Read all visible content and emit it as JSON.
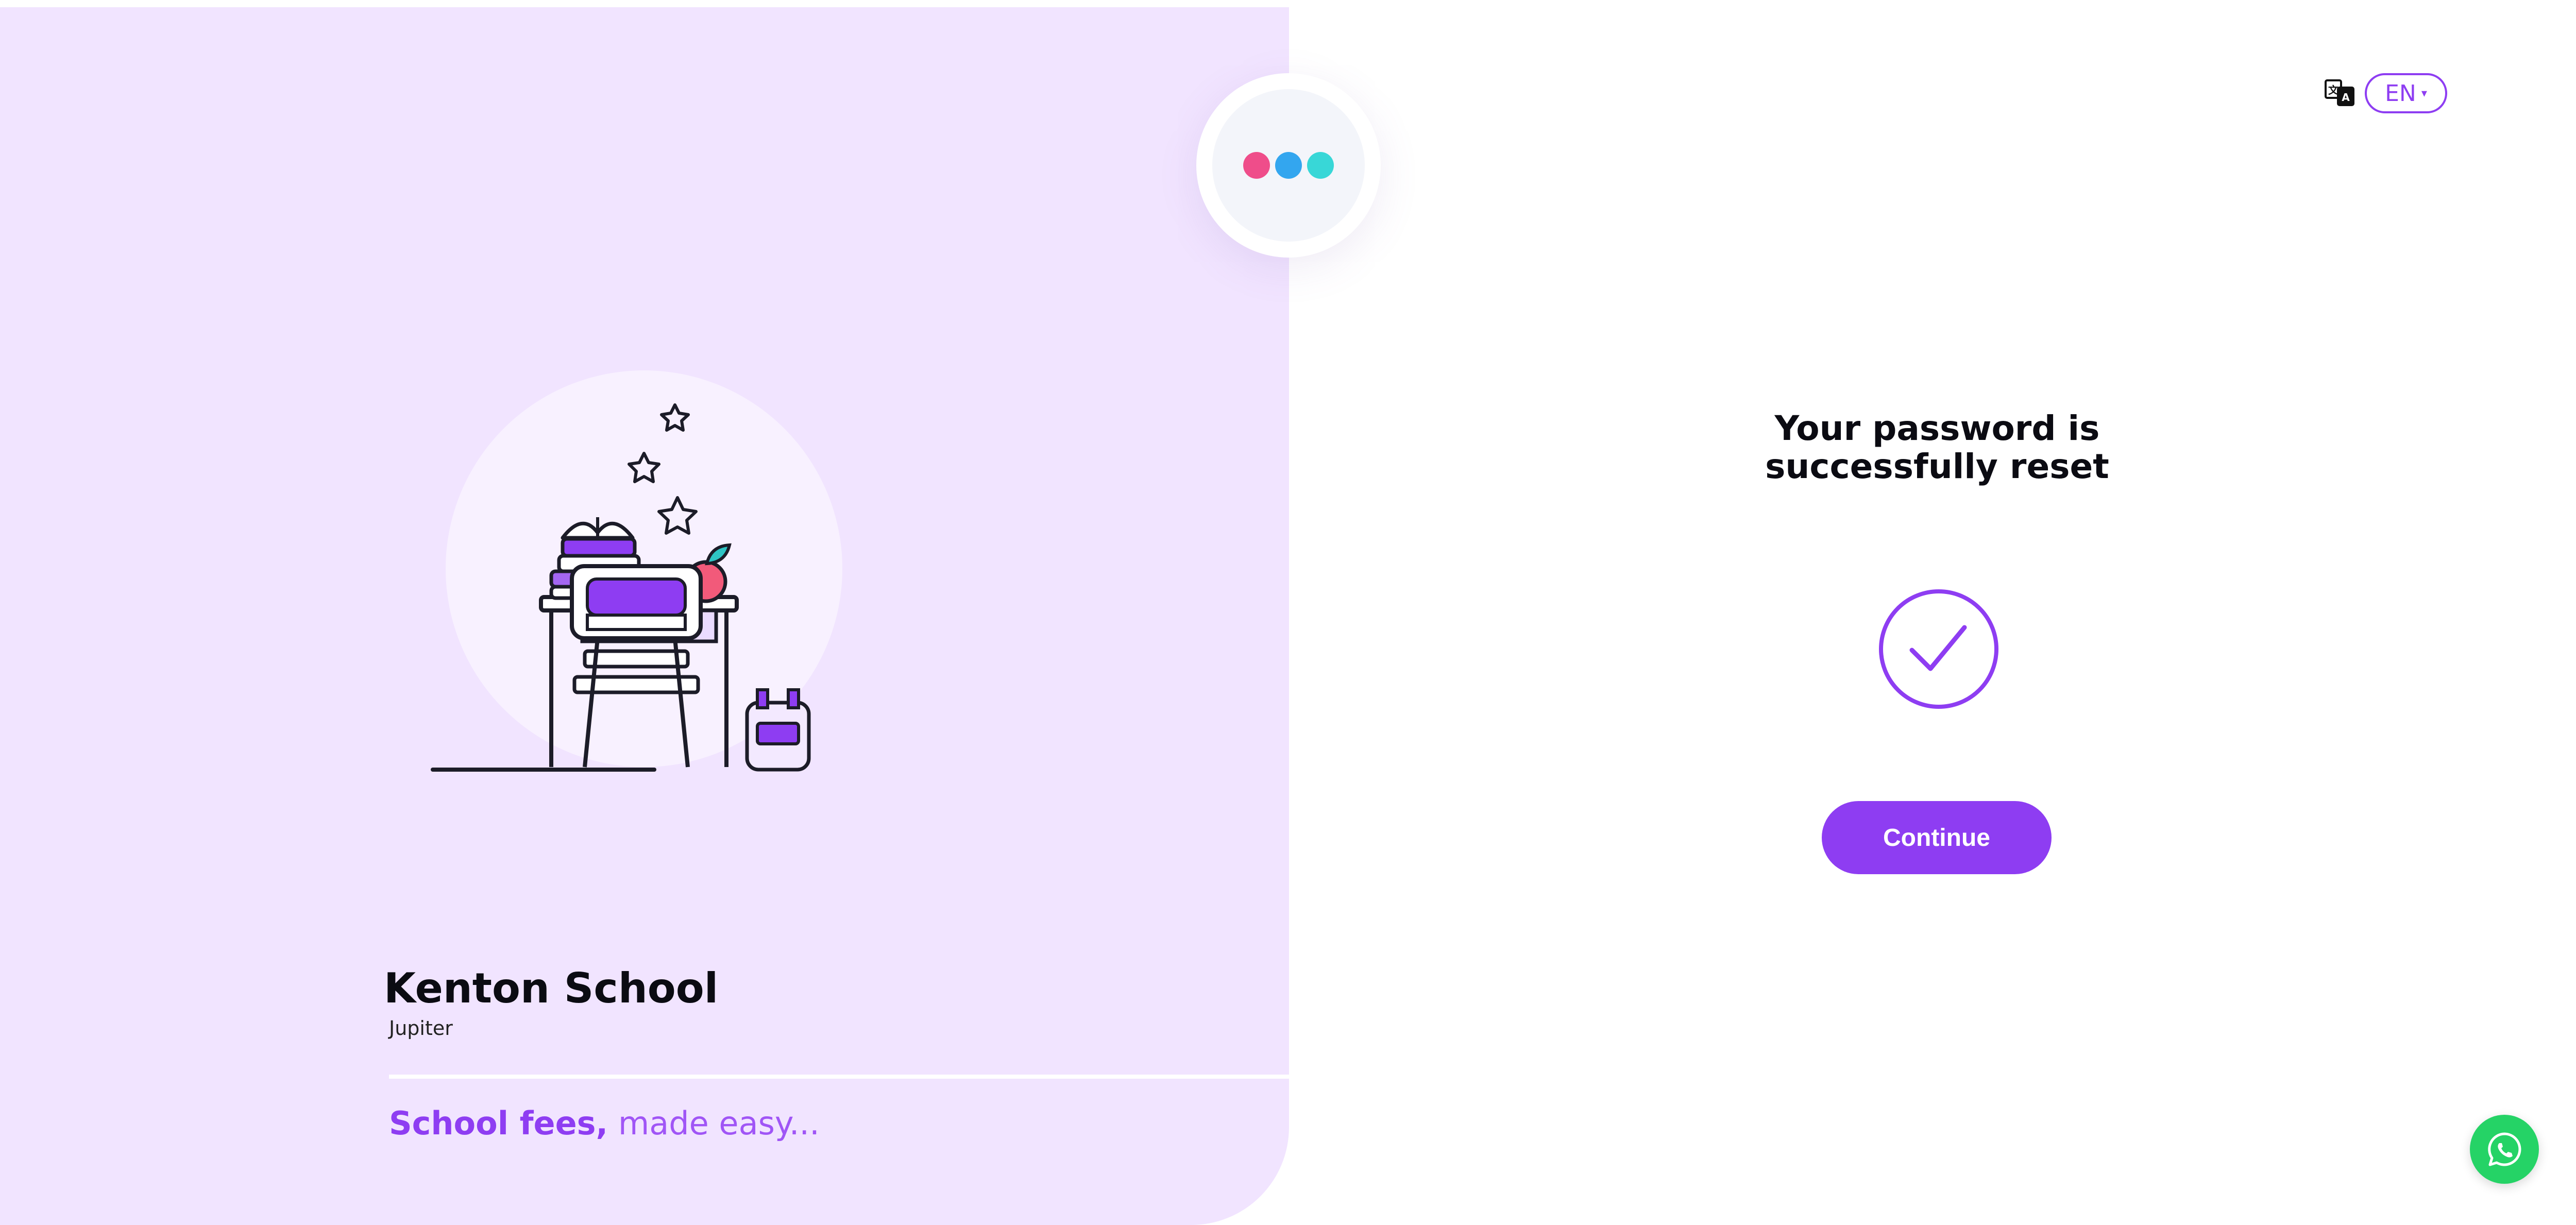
{
  "school": {
    "name": "Kenton School",
    "location": "Jupiter"
  },
  "tagline": {
    "strong": "School fees,",
    "soft": "made easy..."
  },
  "language": {
    "selected": "EN",
    "caret": "▾"
  },
  "reset": {
    "title_line1": "Your password is",
    "title_line2": "successfully reset",
    "continue_label": "Continue"
  },
  "icons": {
    "logo": "three-dots-logo",
    "language": "translate-icon",
    "success": "checkmark-circle-icon",
    "chat": "whatsapp-icon"
  },
  "colors": {
    "accent": "#8e3df2",
    "panel": "#f1e4ff",
    "logo_dot_1": "#ef4d8a",
    "logo_dot_2": "#33a6ef",
    "logo_dot_3": "#38d7d7",
    "whatsapp": "#25d366"
  }
}
